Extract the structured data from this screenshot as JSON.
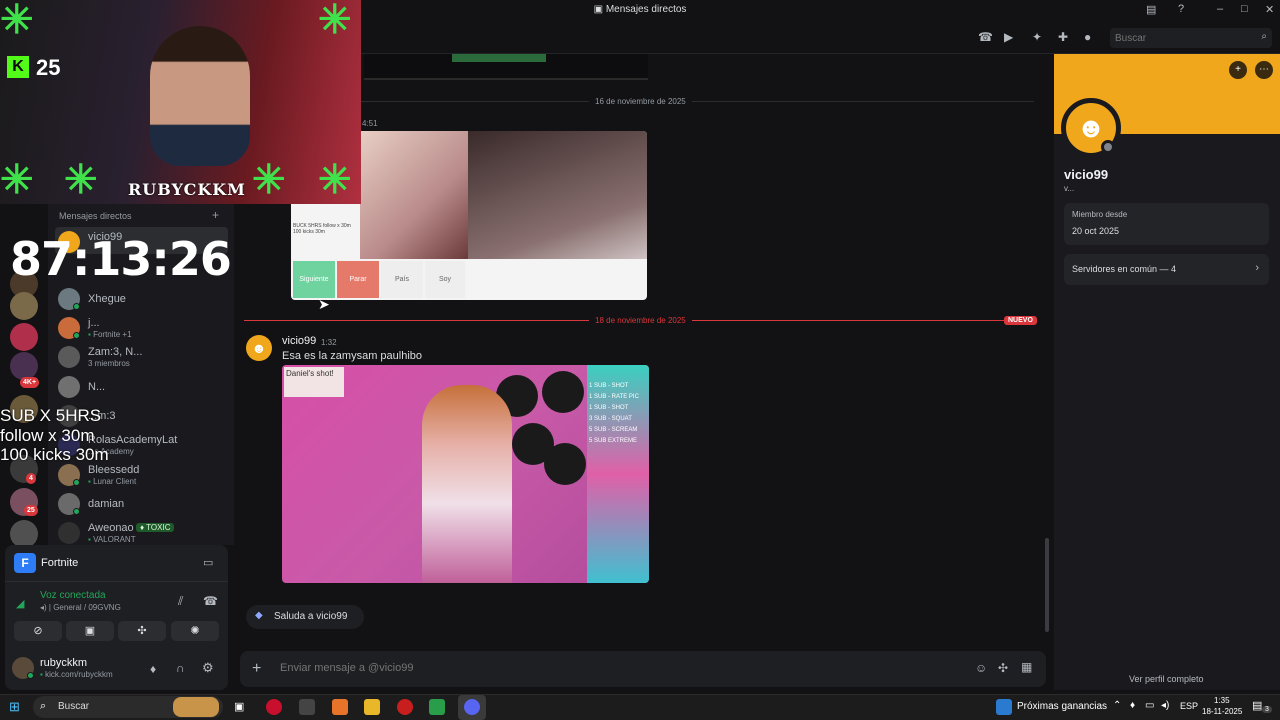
{
  "window": {
    "title": "Mensajes directos"
  },
  "toolbar": {
    "search_placeholder": "Buscar"
  },
  "overlay": {
    "kick_count": "25",
    "streamer_name": "RUBYCKKM",
    "timer": "87:13:26",
    "lines": [
      "SUB X 5HRS",
      "follow x 30m",
      "100 kicks 30m"
    ]
  },
  "sidebar": {
    "header": "Mensajes directos",
    "servers_badges": [
      "4K+",
      "4",
      "25"
    ],
    "dms": [
      {
        "name": "vicio99",
        "sub": ""
      },
      {
        "name": "Xhegue",
        "sub": ""
      },
      {
        "name": "j...",
        "sub": "Fortnite +1"
      },
      {
        "name": "Zam:3, N...",
        "sub": "3 miembros"
      },
      {
        "name": "N...",
        "sub": ""
      },
      {
        "name": "...m:3",
        "sub": ""
      },
      {
        "name": "RolasAcademyLat",
        "sub": "...s Academy"
      },
      {
        "name": "Bleessedd",
        "sub": "Lunar Client"
      },
      {
        "name": "damian",
        "sub": ""
      },
      {
        "name": "Aweonao",
        "sub": "VALORANT",
        "tag": "TOXIC"
      }
    ]
  },
  "activity": {
    "game": "Fortnite"
  },
  "voice": {
    "status": "Voz conectada",
    "channel": "General / 09GVNG"
  },
  "user": {
    "name": "rubyckkm",
    "sub": "kick.com/rubyckkm"
  },
  "chat": {
    "old_time": "4:51",
    "date1": "16 de noviembre de 2025",
    "date2": "18 de noviembre de 2025",
    "new_badge": "NUEVO",
    "screenshot_buttons": [
      "Siguiente",
      "Parar",
      "País",
      "Soy"
    ],
    "screenshot_text": "BUCK 5HRS follow x 30m 100 kicks 30m",
    "message": {
      "author": "vicio99",
      "time": "1:32",
      "text": "Esa es la zamysam paulhibo"
    },
    "image_text": [
      "Daniel's shot!",
      "1 SUB - SHOT",
      "1 SUB - RATE PIC",
      "1 SUB - SHOT",
      "3 SUB - SQUAT",
      "5 SUB - SCREAM",
      "5 SUB EXTREME"
    ],
    "wave": "Saluda a vicio99",
    "composer_placeholder": "Enviar mensaje a @vicio99"
  },
  "profile": {
    "name": "vicio99",
    "status": "v...",
    "member_since_label": "Miembro desde",
    "member_since": "20 oct 2025",
    "mutual_servers": "Servidores en común — 4",
    "full_profile": "Ver perfil completo",
    "banner_color": "#f0a71b"
  },
  "taskbar": {
    "search": "Buscar",
    "news": "Próximas ganancias",
    "lang": "ESP",
    "time": "1:35",
    "date": "18-11-2025",
    "notif": "3"
  },
  "colors": {
    "accent": "#5865f2",
    "green": "#23a55a",
    "red": "#da373c",
    "banner": "#f0a71b"
  }
}
